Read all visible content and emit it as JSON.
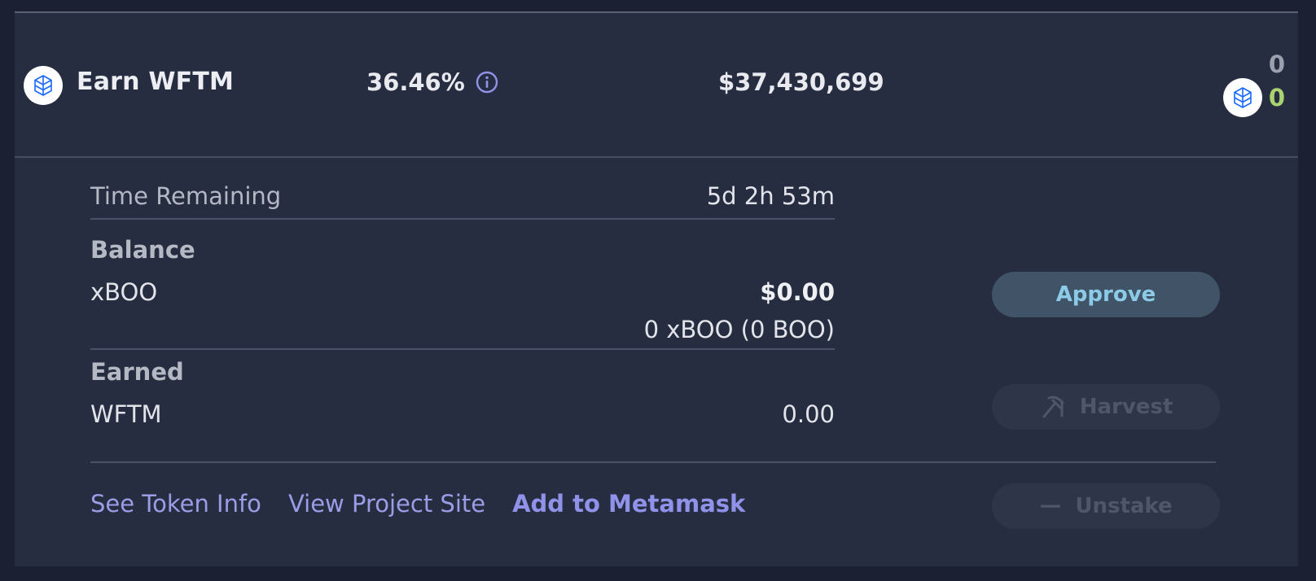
{
  "pool": {
    "title": "Earn WFTM",
    "apr": "36.46%",
    "tvl": "$37,430,699",
    "staked": "0",
    "earned": "0",
    "token_icon": "fantom-token-icon",
    "info_icon": "info-icon"
  },
  "details": {
    "time_remaining_label": "Time Remaining",
    "time_remaining_value": "5d 2h 53m",
    "balance_heading": "Balance",
    "balance_token": "xBOO",
    "balance_usd": "$0.00",
    "balance_amount": "0 xBOO (0 BOO)",
    "earned_heading": "Earned",
    "earned_token": "WFTM",
    "earned_amount": "0.00"
  },
  "links": {
    "token_info": "See Token Info",
    "project_site": "View Project Site",
    "metamask": "Add to Metamask"
  },
  "buttons": {
    "approve": "Approve",
    "harvest": "Harvest",
    "unstake": "Unstake",
    "harvest_icon": "pickaxe-icon",
    "unstake_icon": "minus-icon"
  },
  "colors": {
    "background": "#1b2133",
    "card": "#272d41",
    "accent_link": "#9b9ce6",
    "earned_green": "#a8d36f",
    "approve_bg": "#415467",
    "approve_text": "#8ccbe8"
  }
}
